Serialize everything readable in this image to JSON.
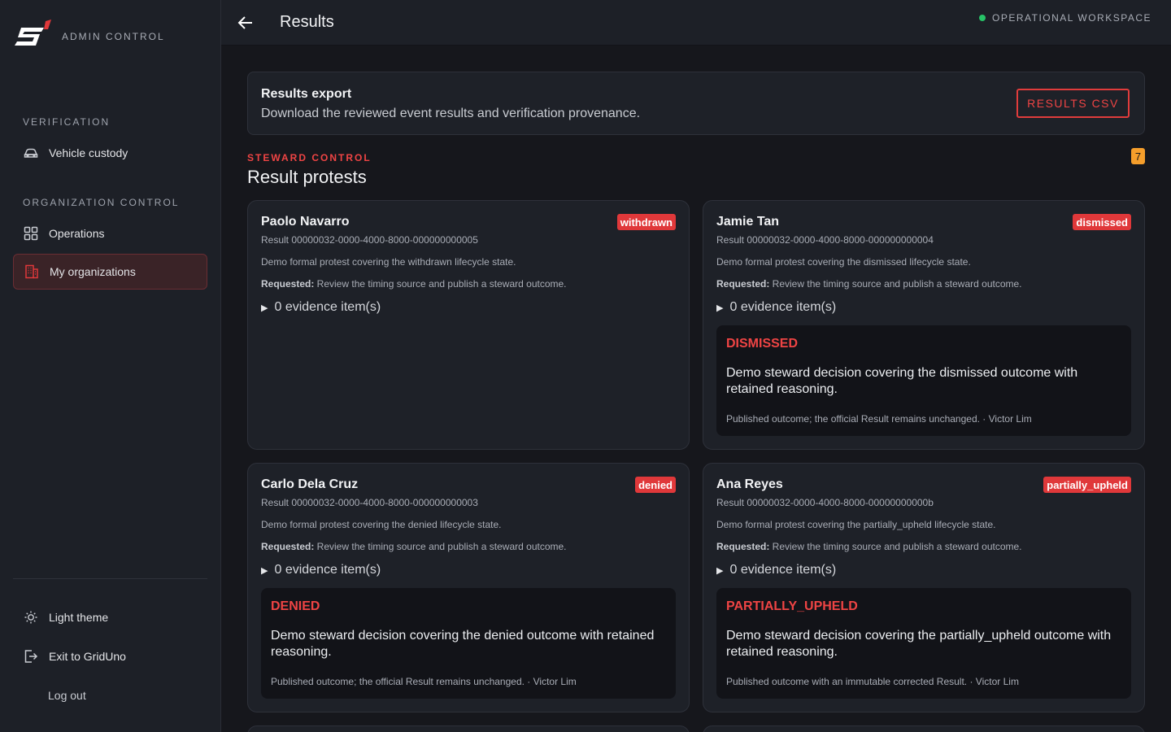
{
  "brand": {
    "text": "ADMIN CONTROL"
  },
  "sidebar": {
    "verification_label": "VERIFICATION",
    "vehicle_custody": "Vehicle custody",
    "org_control_label": "ORGANIZATION CONTROL",
    "operations": "Operations",
    "my_organizations": "My organizations",
    "light_theme": "Light theme",
    "exit": "Exit to GridUno",
    "logout": "Log out"
  },
  "header": {
    "title": "Results",
    "status": "OPERATIONAL WORKSPACE",
    "status_color": "#27c267"
  },
  "export": {
    "title": "Results export",
    "description": "Download the reviewed event results and verification provenance.",
    "button": "RESULTS CSV"
  },
  "section": {
    "eyebrow": "STEWARD CONTROL",
    "title": "Result protests",
    "count": "7"
  },
  "protests": [
    {
      "name": "Paolo Navarro",
      "status": "withdrawn",
      "result": "Result 00000032-0000-4000-8000-000000000005",
      "description": "Demo formal protest covering the withdrawn lifecycle state.",
      "requested_label": "Requested:",
      "requested": " Review the timing source and publish a steward outcome.",
      "evidence": "0 evidence item(s)"
    },
    {
      "name": "Jamie Tan",
      "status": "dismissed",
      "result": "Result 00000032-0000-4000-8000-000000000004",
      "description": "Demo formal protest covering the dismissed lifecycle state.",
      "requested_label": "Requested:",
      "requested": " Review the timing source and publish a steward outcome.",
      "evidence": "0 evidence item(s)",
      "decision": {
        "title": "DISMISSED",
        "text": "Demo steward decision covering the dismissed outcome with retained reasoning.",
        "meta": "Published outcome; the official Result remains unchanged. · Victor Lim"
      }
    },
    {
      "name": "Carlo Dela Cruz",
      "status": "denied",
      "result": "Result 00000032-0000-4000-8000-000000000003",
      "description": "Demo formal protest covering the denied lifecycle state.",
      "requested_label": "Requested:",
      "requested": " Review the timing source and publish a steward outcome.",
      "evidence": "0 evidence item(s)",
      "decision": {
        "title": "DENIED",
        "text": "Demo steward decision covering the denied outcome with retained reasoning.",
        "meta": "Published outcome; the official Result remains unchanged. · Victor Lim"
      }
    },
    {
      "name": "Ana Reyes",
      "status": "partially_upheld",
      "result": "Result 00000032-0000-4000-8000-00000000000b",
      "description": "Demo formal protest covering the partially_upheld lifecycle state.",
      "requested_label": "Requested:",
      "requested": " Review the timing source and publish a steward outcome.",
      "evidence": "0 evidence item(s)",
      "decision": {
        "title": "PARTIALLY_UPHELD",
        "text": "Demo steward decision covering the partially_upheld outcome with retained reasoning.",
        "meta": "Published outcome with an immutable corrected Result. · Victor Lim"
      }
    }
  ],
  "colors": {
    "accent": "#ef4444",
    "badge": "#e0383a",
    "count_badge": "#f59e2b",
    "background": "#16171c",
    "sidebar": "#1d2027"
  }
}
